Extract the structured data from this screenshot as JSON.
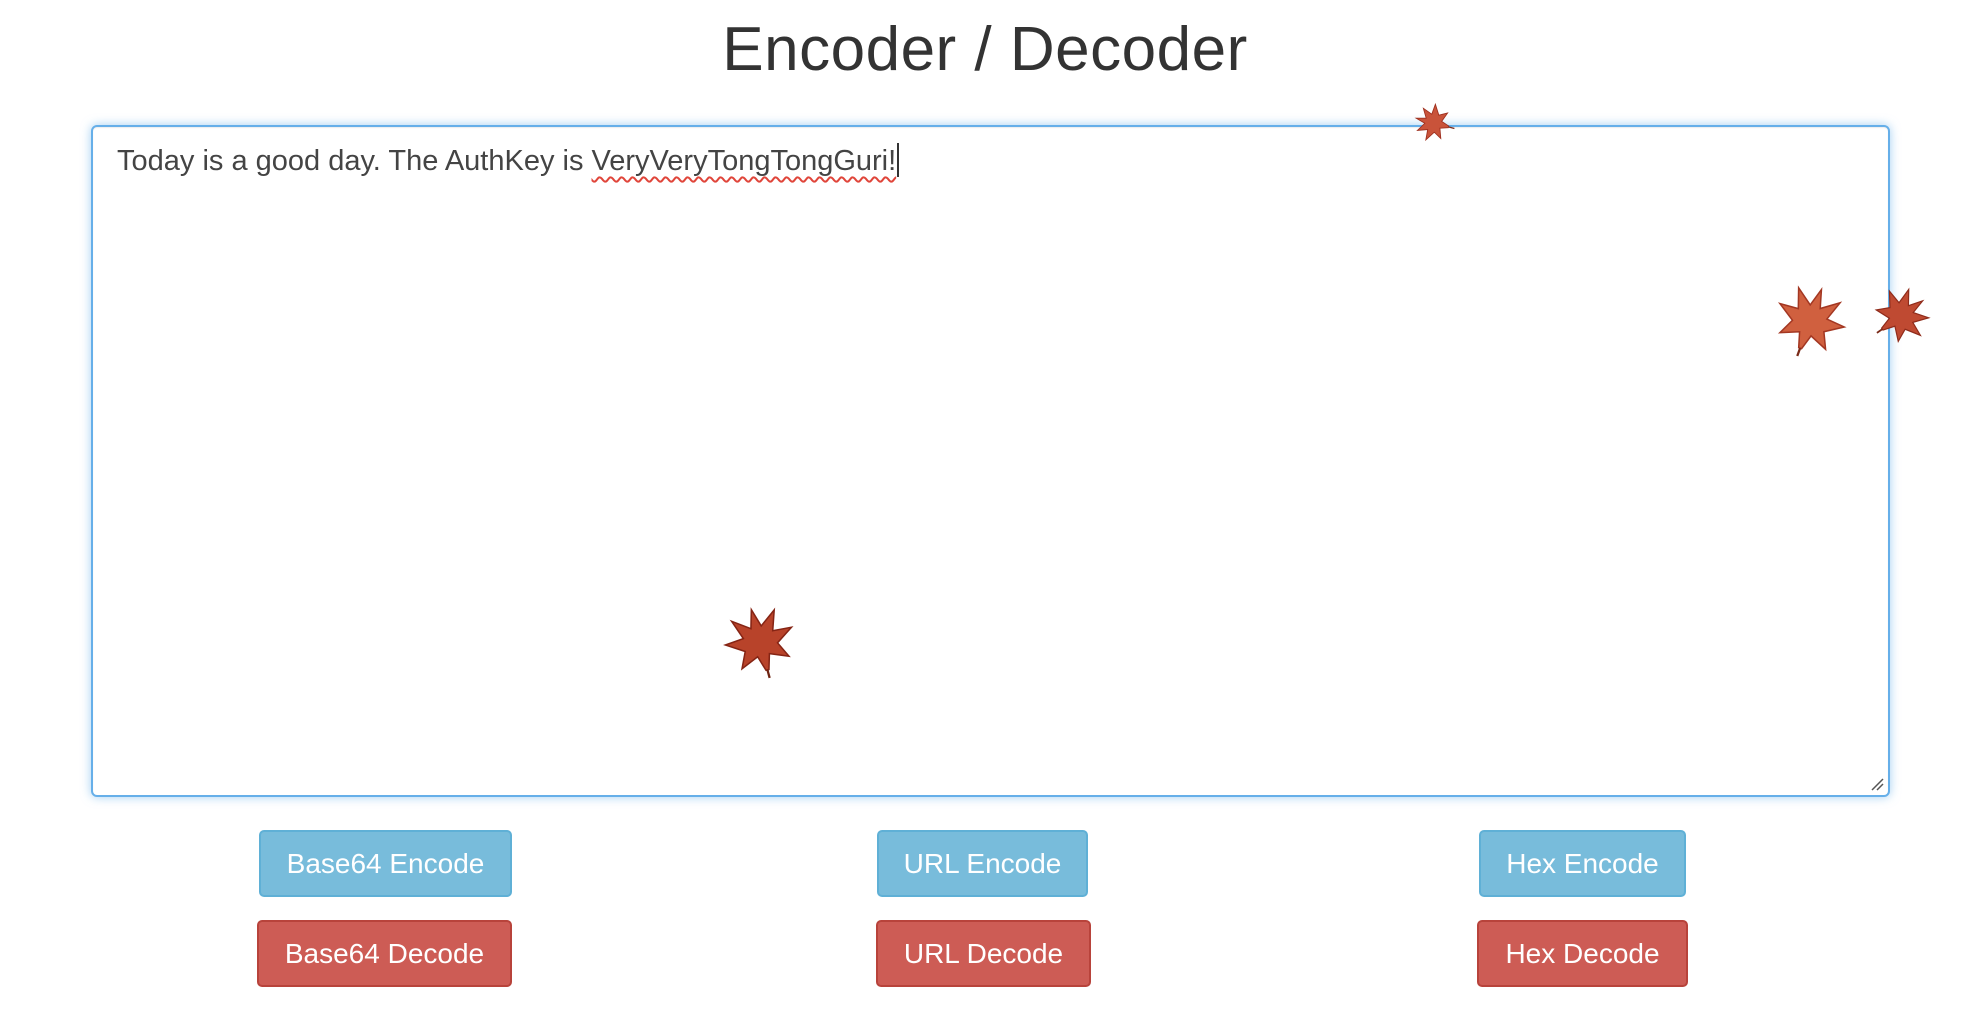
{
  "page": {
    "title": "Encoder / Decoder"
  },
  "editor": {
    "text_plain": "Today is a good day. The AuthKey is ",
    "text_misspelled": "VeryVeryTongTongGuri!"
  },
  "buttons": {
    "base64_encode": "Base64 Encode",
    "base64_decode": "Base64 Decode",
    "url_encode": "URL Encode",
    "url_decode": "URL Decode",
    "hex_encode": "Hex Encode",
    "hex_decode": "Hex Decode"
  },
  "colors": {
    "encode_button": "#78bcdb",
    "decode_button": "#cd5c55",
    "focus_border": "#66afe9",
    "leaf": "#b8432a"
  },
  "decorations": {
    "falling_leaves": "maple-leaf-icon"
  }
}
